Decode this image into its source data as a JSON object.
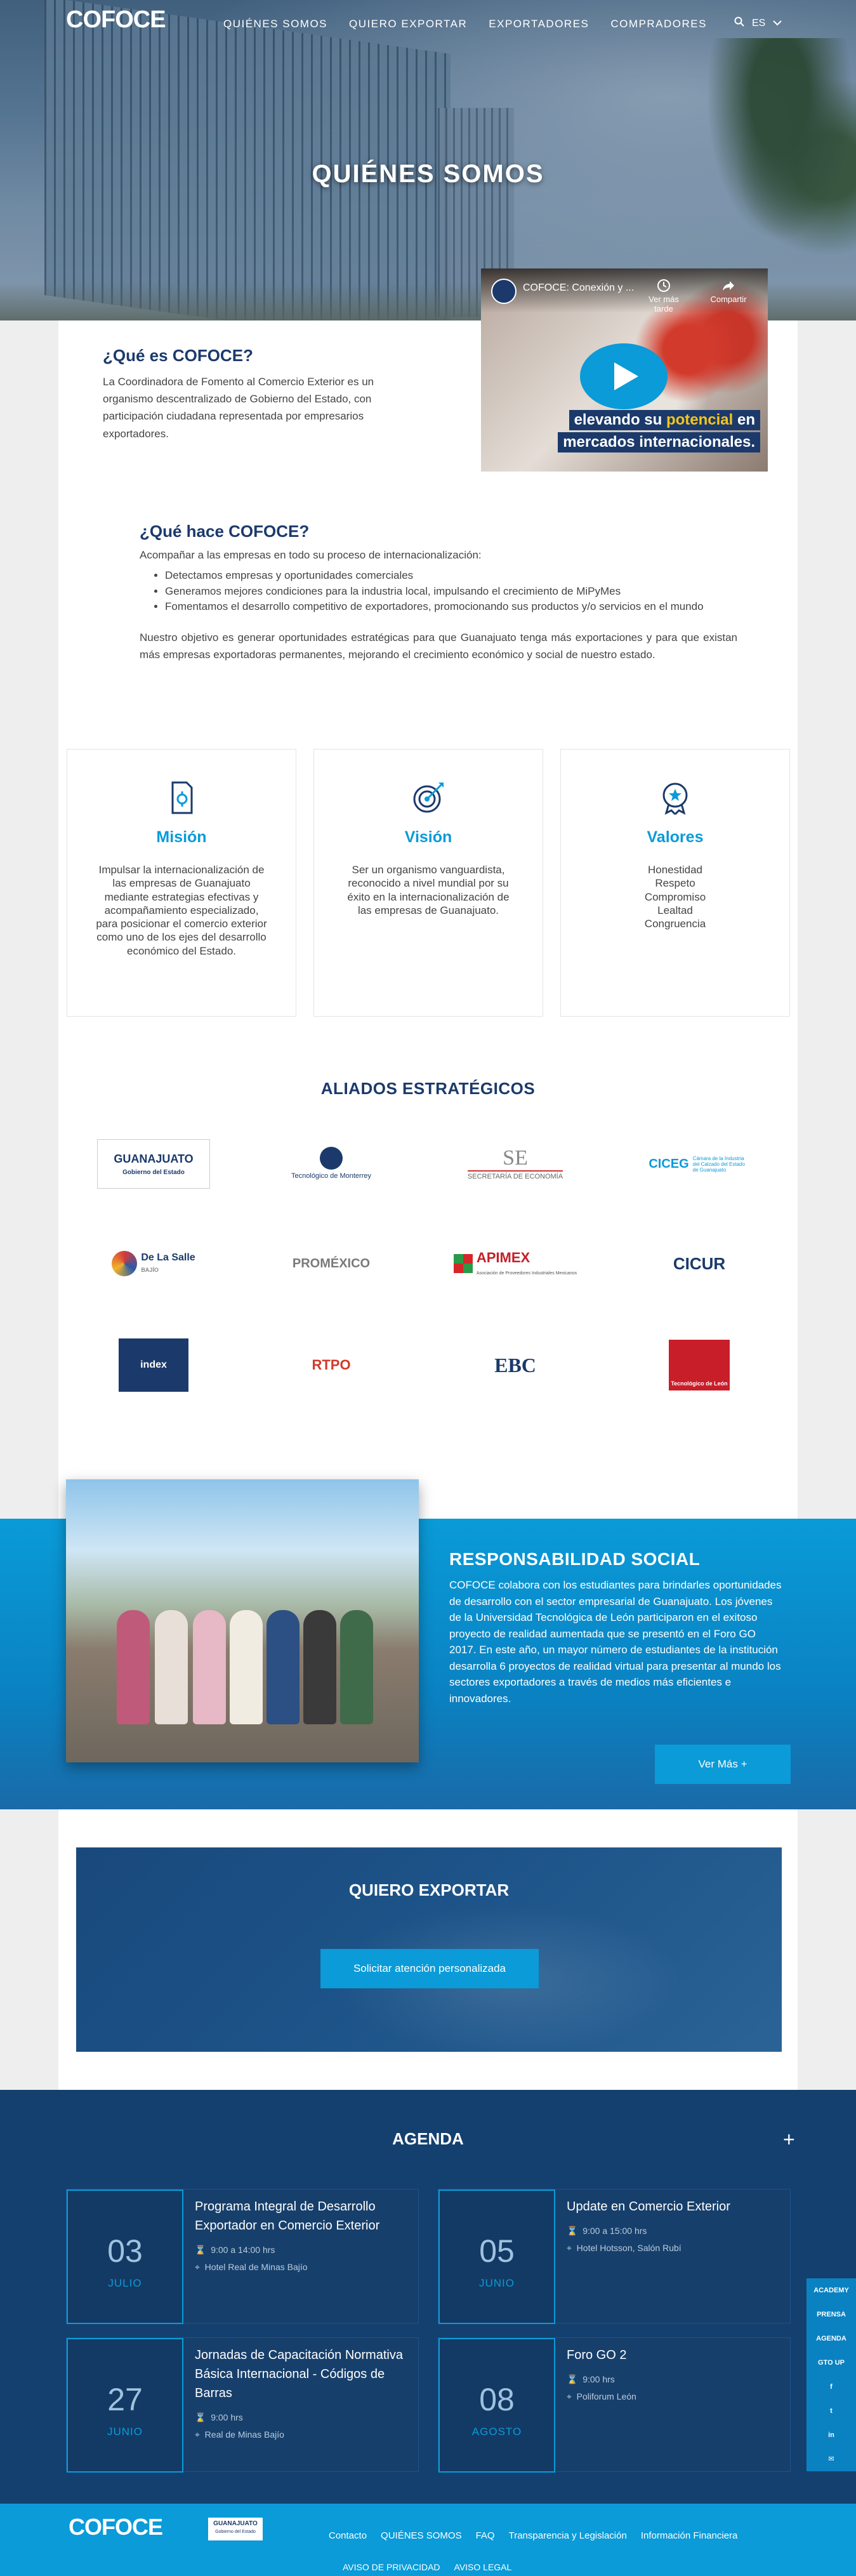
{
  "brand": {
    "logo": "COFOCE",
    "accent": "#0a9bd8",
    "navy": "#1b3a6b"
  },
  "nav": {
    "items": [
      "QUIÉNES SOMOS",
      "QUIERO EXPORTAR",
      "EXPORTADORES",
      "COMPRADORES"
    ],
    "search_icon": "search-icon",
    "lang": "ES"
  },
  "hero": {
    "title": "QUIÉNES SOMOS"
  },
  "about": {
    "title": "¿Qué es COFOCE?",
    "text": "La Coordinadora de Fomento al Comercio Exterior es un organismo descentralizado de Gobierno del Estado, con participación ciudadana representada por empresarios exportadores.",
    "video": {
      "title": "COFOCE: Conexión y ...",
      "watch_later": "Ver más tarde",
      "share": "Compartir",
      "caption_1_prefix": "elevando su ",
      "caption_1_highlight": "potencial",
      "caption_1_suffix": " en",
      "caption_2": "mercados internacionales."
    }
  },
  "what": {
    "title": "¿Qué hace COFOCE?",
    "intro": "Acompañar a las empresas en todo su proceso de internacionalización:",
    "bullets": [
      "Detectamos empresas y oportunidades comerciales",
      "Generamos mejores condiciones para la industria local, impulsando el crecimiento de MiPyMes",
      "Fomentamos el desarrollo competitivo de exportadores, promocionando sus productos y/o servicios en el mundo"
    ],
    "objective": "Nuestro objetivo es generar oportunidades estratégicas para que Guanajuato tenga más exportaciones y para que existan más empresas exportadoras permanentes, mejorando el crecimiento económico y social de nuestro estado."
  },
  "cards": [
    {
      "title": "Misión",
      "icon": "document-gear-icon",
      "text": "Impulsar la internacionalización de las empresas de Guanajuato mediante estrategias efectivas y acompañamiento especializado, para posicionar el comercio exterior como uno de los ejes del desarrollo económico del Estado."
    },
    {
      "title": "Visión",
      "icon": "target-icon",
      "text": "Ser un organismo vanguardista, reconocido a nivel mundial por su éxito en la internacionalización de las empresas de Guanajuato."
    },
    {
      "title": "Valores",
      "icon": "star-badge-icon",
      "text_lines": [
        "Honestidad",
        "Respeto",
        "Compromiso",
        "Lealtad",
        "Congruencia"
      ]
    }
  ],
  "allies": {
    "title": "ALIADOS ESTRATÉGICOS",
    "logos": [
      {
        "name": "GUANAJUATO",
        "sub": "Gobierno del Estado"
      },
      {
        "name": "Tecnológico de Monterrey"
      },
      {
        "name": "SE",
        "sub": "SECRETARÍA DE ECONOMÍA"
      },
      {
        "name": "CICEG",
        "sub": "Cámara de la Industria del Calzado del Estado de Guanajuato"
      },
      {
        "name": "De La Salle",
        "sub": "BAJÍO"
      },
      {
        "name": "PROMÉXICO"
      },
      {
        "name": "APIMEX",
        "sub": "Asociación de Proveedores Industriales Mexicanos"
      },
      {
        "name": "CICUR"
      },
      {
        "name": "index"
      },
      {
        "name": "RTPO"
      },
      {
        "name": "EBC"
      },
      {
        "name": "Tecnológico de León"
      }
    ]
  },
  "social": {
    "title": "RESPONSABILIDAD SOCIAL",
    "text": "COFOCE colabora con los estudiantes para brindarles oportunidades de desarrollo con el sector empresarial de Guanajuato. Los jóvenes de la Universidad Tecnológica de León participaron en el exitoso proyecto de realidad aumentada que se presentó en el Foro GO 2017. En este año, un mayor número de estudiantes de la institución desarrolla 6 proyectos de realidad virtual para presentar al mundo los sectores exportadores a través de medios más eficientes e innovadores.",
    "button": "Ver Más +"
  },
  "export": {
    "title": "QUIERO EXPORTAR",
    "button": "Solicitar atención personalizada"
  },
  "agenda": {
    "title": "AGENDA",
    "plus": "+",
    "events": [
      {
        "day": "03",
        "month": "JULIO",
        "title": "Programa Integral de Desarrollo Exportador en Comercio Exterior",
        "time": "9:00 a 14:00 hrs",
        "place": "Hotel Real de Minas Bajío"
      },
      {
        "day": "05",
        "month": "JUNIO",
        "title": "Update en Comercio Exterior",
        "time": "9:00 a 15:00 hrs",
        "place": "Hotel Hotsson, Salón Rubí"
      },
      {
        "day": "27",
        "month": "JUNIO",
        "title": "Jornadas de Capacitación Normativa Básica Internacional - Códigos de Barras",
        "time": "9:00 hrs",
        "place": "Real de Minas Bajío"
      },
      {
        "day": "08",
        "month": "AGOSTO",
        "title": "Foro GO 2",
        "time": "9:00 hrs",
        "place": "Poliforum León"
      }
    ]
  },
  "side_menu": [
    "ACADEMY",
    "PRENSA",
    "AGENDA",
    "GTO UP",
    "f",
    "t",
    "in",
    "✉"
  ],
  "footer": {
    "logo": "COFOCE",
    "gto": "GUANAJUATO",
    "gto_sub": "Gobierno del Estado",
    "links": [
      "Contacto",
      "QUIÉNES SOMOS",
      "FAQ",
      "Transparencia y Legislación",
      "Información Financiera"
    ],
    "legal": [
      "AVISO DE PRIVACIDAD",
      "AVISO LEGAL"
    ]
  }
}
